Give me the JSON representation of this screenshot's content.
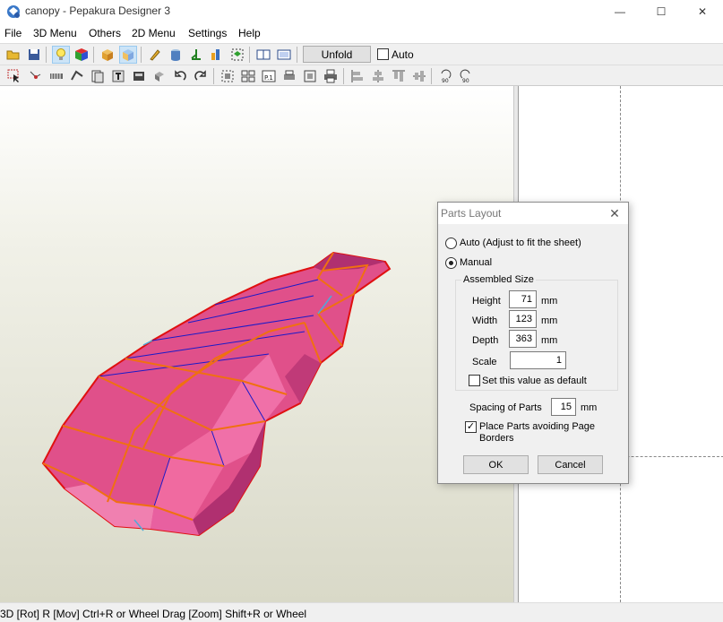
{
  "window": {
    "title": "canopy - Pepakura Designer 3",
    "minimize_glyph": "—",
    "maximize_glyph": "☐",
    "close_glyph": "✕"
  },
  "menu": [
    "File",
    "3D Menu",
    "Others",
    "2D Menu",
    "Settings",
    "Help"
  ],
  "toolbar": {
    "unfold_label": "Unfold",
    "auto_label": "Auto",
    "auto_checked": false
  },
  "status_bar": {
    "text": "3D [Rot] R [Mov] Ctrl+R or Wheel Drag [Zoom] Shift+R or Wheel"
  },
  "dialog": {
    "title": "Parts Layout",
    "close_glyph": "✕",
    "auto_option": "Auto (Adjust to fit the sheet)",
    "manual_option": "Manual",
    "selected_option": "manual",
    "assembled_size_label": "Assembled Size",
    "height_label": "Height",
    "height_value": "71",
    "width_label": "Width",
    "width_value": "123",
    "depth_label": "Depth",
    "depth_value": "363",
    "unit": "mm",
    "scale_label": "Scale",
    "scale_value": "1",
    "set_default_label": "Set this value as default",
    "set_default_checked": false,
    "spacing_label": "Spacing of Parts",
    "spacing_value": "15",
    "avoid_borders_label_1": "Place Parts avoiding Page",
    "avoid_borders_label_2": "Borders",
    "avoid_borders_checked": true,
    "ok_label": "OK",
    "cancel_label": "Cancel"
  },
  "colors": {
    "model_fill": "#e0508a",
    "model_edge_cut": "#f07010",
    "model_edge_fold": "#1a1ac8",
    "model_edge_outline": "#e01010",
    "background_bottom": "#d9d9c8"
  }
}
